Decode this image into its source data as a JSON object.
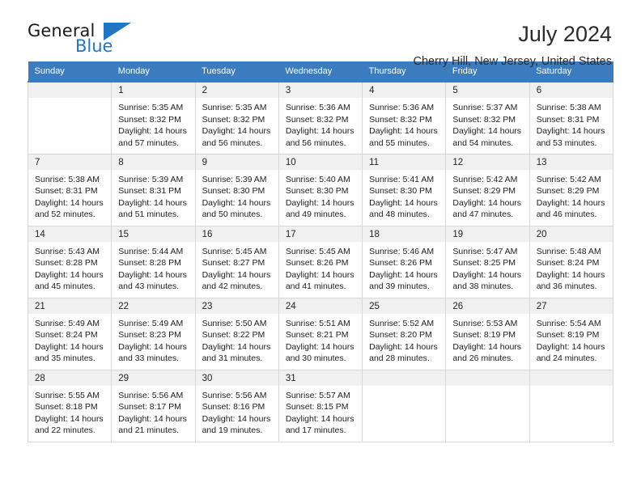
{
  "brand": {
    "name_dark": "General",
    "name_blue": "Blue",
    "accent_color": "#1f76c2"
  },
  "header": {
    "title": "July 2024",
    "subtitle": "Cherry Hill, New Jersey, United States",
    "header_bg": "#3a7cbe",
    "daynum_bg": "#f0f0f0"
  },
  "weekdays": [
    "Sunday",
    "Monday",
    "Tuesday",
    "Wednesday",
    "Thursday",
    "Friday",
    "Saturday"
  ],
  "weeks": [
    [
      {
        "day": ""
      },
      {
        "day": "1",
        "sunrise": "Sunrise: 5:35 AM",
        "sunset": "Sunset: 8:32 PM",
        "daylight1": "Daylight: 14 hours",
        "daylight2": "and 57 minutes."
      },
      {
        "day": "2",
        "sunrise": "Sunrise: 5:35 AM",
        "sunset": "Sunset: 8:32 PM",
        "daylight1": "Daylight: 14 hours",
        "daylight2": "and 56 minutes."
      },
      {
        "day": "3",
        "sunrise": "Sunrise: 5:36 AM",
        "sunset": "Sunset: 8:32 PM",
        "daylight1": "Daylight: 14 hours",
        "daylight2": "and 56 minutes."
      },
      {
        "day": "4",
        "sunrise": "Sunrise: 5:36 AM",
        "sunset": "Sunset: 8:32 PM",
        "daylight1": "Daylight: 14 hours",
        "daylight2": "and 55 minutes."
      },
      {
        "day": "5",
        "sunrise": "Sunrise: 5:37 AM",
        "sunset": "Sunset: 8:32 PM",
        "daylight1": "Daylight: 14 hours",
        "daylight2": "and 54 minutes."
      },
      {
        "day": "6",
        "sunrise": "Sunrise: 5:38 AM",
        "sunset": "Sunset: 8:31 PM",
        "daylight1": "Daylight: 14 hours",
        "daylight2": "and 53 minutes."
      }
    ],
    [
      {
        "day": "7",
        "sunrise": "Sunrise: 5:38 AM",
        "sunset": "Sunset: 8:31 PM",
        "daylight1": "Daylight: 14 hours",
        "daylight2": "and 52 minutes."
      },
      {
        "day": "8",
        "sunrise": "Sunrise: 5:39 AM",
        "sunset": "Sunset: 8:31 PM",
        "daylight1": "Daylight: 14 hours",
        "daylight2": "and 51 minutes."
      },
      {
        "day": "9",
        "sunrise": "Sunrise: 5:39 AM",
        "sunset": "Sunset: 8:30 PM",
        "daylight1": "Daylight: 14 hours",
        "daylight2": "and 50 minutes."
      },
      {
        "day": "10",
        "sunrise": "Sunrise: 5:40 AM",
        "sunset": "Sunset: 8:30 PM",
        "daylight1": "Daylight: 14 hours",
        "daylight2": "and 49 minutes."
      },
      {
        "day": "11",
        "sunrise": "Sunrise: 5:41 AM",
        "sunset": "Sunset: 8:30 PM",
        "daylight1": "Daylight: 14 hours",
        "daylight2": "and 48 minutes."
      },
      {
        "day": "12",
        "sunrise": "Sunrise: 5:42 AM",
        "sunset": "Sunset: 8:29 PM",
        "daylight1": "Daylight: 14 hours",
        "daylight2": "and 47 minutes."
      },
      {
        "day": "13",
        "sunrise": "Sunrise: 5:42 AM",
        "sunset": "Sunset: 8:29 PM",
        "daylight1": "Daylight: 14 hours",
        "daylight2": "and 46 minutes."
      }
    ],
    [
      {
        "day": "14",
        "sunrise": "Sunrise: 5:43 AM",
        "sunset": "Sunset: 8:28 PM",
        "daylight1": "Daylight: 14 hours",
        "daylight2": "and 45 minutes."
      },
      {
        "day": "15",
        "sunrise": "Sunrise: 5:44 AM",
        "sunset": "Sunset: 8:28 PM",
        "daylight1": "Daylight: 14 hours",
        "daylight2": "and 43 minutes."
      },
      {
        "day": "16",
        "sunrise": "Sunrise: 5:45 AM",
        "sunset": "Sunset: 8:27 PM",
        "daylight1": "Daylight: 14 hours",
        "daylight2": "and 42 minutes."
      },
      {
        "day": "17",
        "sunrise": "Sunrise: 5:45 AM",
        "sunset": "Sunset: 8:26 PM",
        "daylight1": "Daylight: 14 hours",
        "daylight2": "and 41 minutes."
      },
      {
        "day": "18",
        "sunrise": "Sunrise: 5:46 AM",
        "sunset": "Sunset: 8:26 PM",
        "daylight1": "Daylight: 14 hours",
        "daylight2": "and 39 minutes."
      },
      {
        "day": "19",
        "sunrise": "Sunrise: 5:47 AM",
        "sunset": "Sunset: 8:25 PM",
        "daylight1": "Daylight: 14 hours",
        "daylight2": "and 38 minutes."
      },
      {
        "day": "20",
        "sunrise": "Sunrise: 5:48 AM",
        "sunset": "Sunset: 8:24 PM",
        "daylight1": "Daylight: 14 hours",
        "daylight2": "and 36 minutes."
      }
    ],
    [
      {
        "day": "21",
        "sunrise": "Sunrise: 5:49 AM",
        "sunset": "Sunset: 8:24 PM",
        "daylight1": "Daylight: 14 hours",
        "daylight2": "and 35 minutes."
      },
      {
        "day": "22",
        "sunrise": "Sunrise: 5:49 AM",
        "sunset": "Sunset: 8:23 PM",
        "daylight1": "Daylight: 14 hours",
        "daylight2": "and 33 minutes."
      },
      {
        "day": "23",
        "sunrise": "Sunrise: 5:50 AM",
        "sunset": "Sunset: 8:22 PM",
        "daylight1": "Daylight: 14 hours",
        "daylight2": "and 31 minutes."
      },
      {
        "day": "24",
        "sunrise": "Sunrise: 5:51 AM",
        "sunset": "Sunset: 8:21 PM",
        "daylight1": "Daylight: 14 hours",
        "daylight2": "and 30 minutes."
      },
      {
        "day": "25",
        "sunrise": "Sunrise: 5:52 AM",
        "sunset": "Sunset: 8:20 PM",
        "daylight1": "Daylight: 14 hours",
        "daylight2": "and 28 minutes."
      },
      {
        "day": "26",
        "sunrise": "Sunrise: 5:53 AM",
        "sunset": "Sunset: 8:19 PM",
        "daylight1": "Daylight: 14 hours",
        "daylight2": "and 26 minutes."
      },
      {
        "day": "27",
        "sunrise": "Sunrise: 5:54 AM",
        "sunset": "Sunset: 8:19 PM",
        "daylight1": "Daylight: 14 hours",
        "daylight2": "and 24 minutes."
      }
    ],
    [
      {
        "day": "28",
        "sunrise": "Sunrise: 5:55 AM",
        "sunset": "Sunset: 8:18 PM",
        "daylight1": "Daylight: 14 hours",
        "daylight2": "and 22 minutes."
      },
      {
        "day": "29",
        "sunrise": "Sunrise: 5:56 AM",
        "sunset": "Sunset: 8:17 PM",
        "daylight1": "Daylight: 14 hours",
        "daylight2": "and 21 minutes."
      },
      {
        "day": "30",
        "sunrise": "Sunrise: 5:56 AM",
        "sunset": "Sunset: 8:16 PM",
        "daylight1": "Daylight: 14 hours",
        "daylight2": "and 19 minutes."
      },
      {
        "day": "31",
        "sunrise": "Sunrise: 5:57 AM",
        "sunset": "Sunset: 8:15 PM",
        "daylight1": "Daylight: 14 hours",
        "daylight2": "and 17 minutes."
      },
      {
        "day": ""
      },
      {
        "day": ""
      },
      {
        "day": ""
      }
    ]
  ]
}
